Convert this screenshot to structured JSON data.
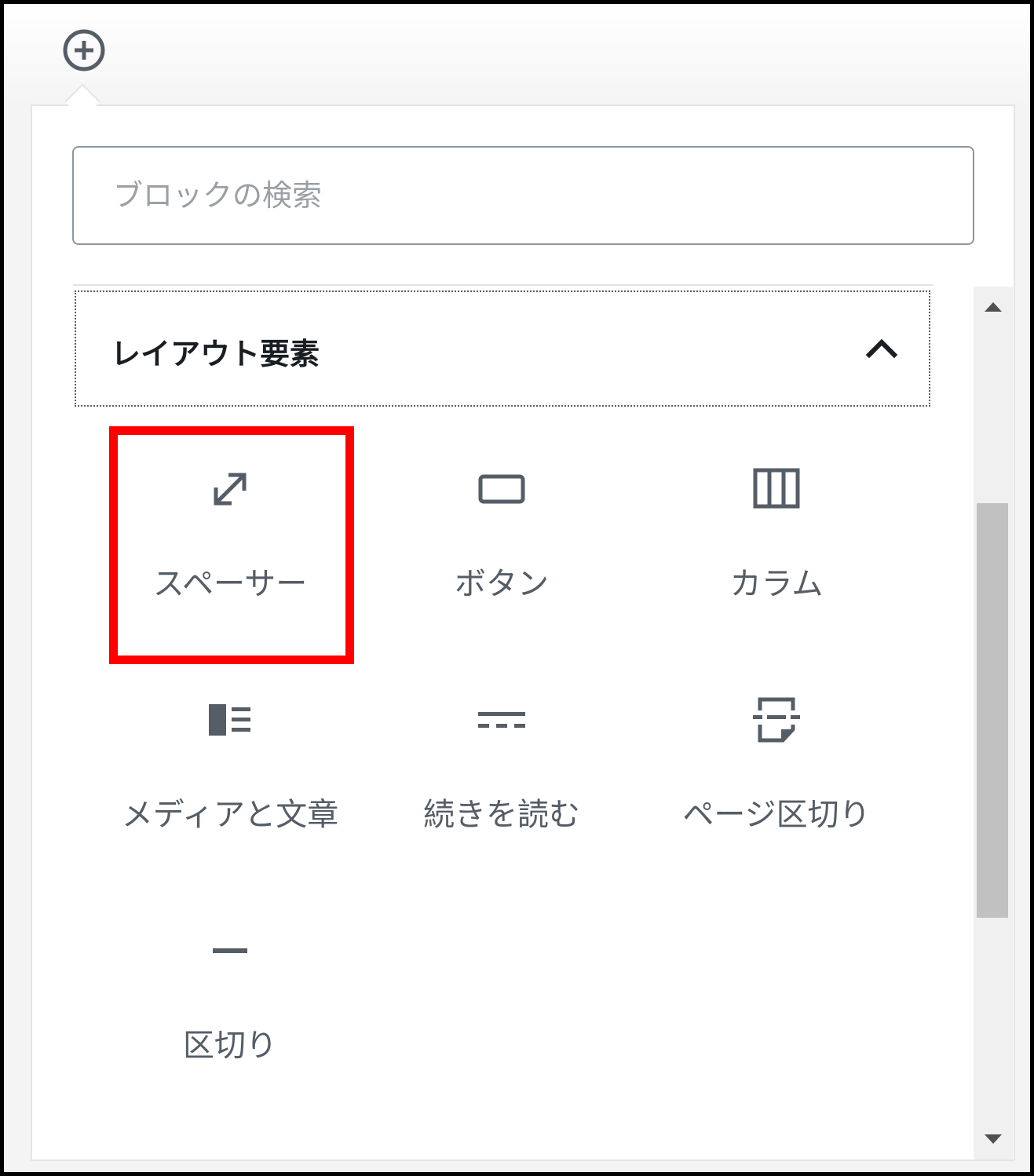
{
  "search": {
    "placeholder": "ブロックの検索"
  },
  "panel": {
    "title": "レイアウト要素",
    "expanded": true
  },
  "blocks": [
    {
      "label": "スペーサー",
      "icon": "resize-arrows-icon",
      "highlighted": true
    },
    {
      "label": "ボタン",
      "icon": "button-icon"
    },
    {
      "label": "カラム",
      "icon": "columns-icon"
    },
    {
      "label": "メディアと文章",
      "icon": "media-text-icon"
    },
    {
      "label": "続きを読む",
      "icon": "more-icon"
    },
    {
      "label": "ページ区切り",
      "icon": "page-break-icon"
    },
    {
      "label": "区切り",
      "icon": "separator-icon"
    }
  ],
  "colors": {
    "highlight": "#ff0000",
    "icon": "#555d66",
    "border": "#8d96a0"
  }
}
